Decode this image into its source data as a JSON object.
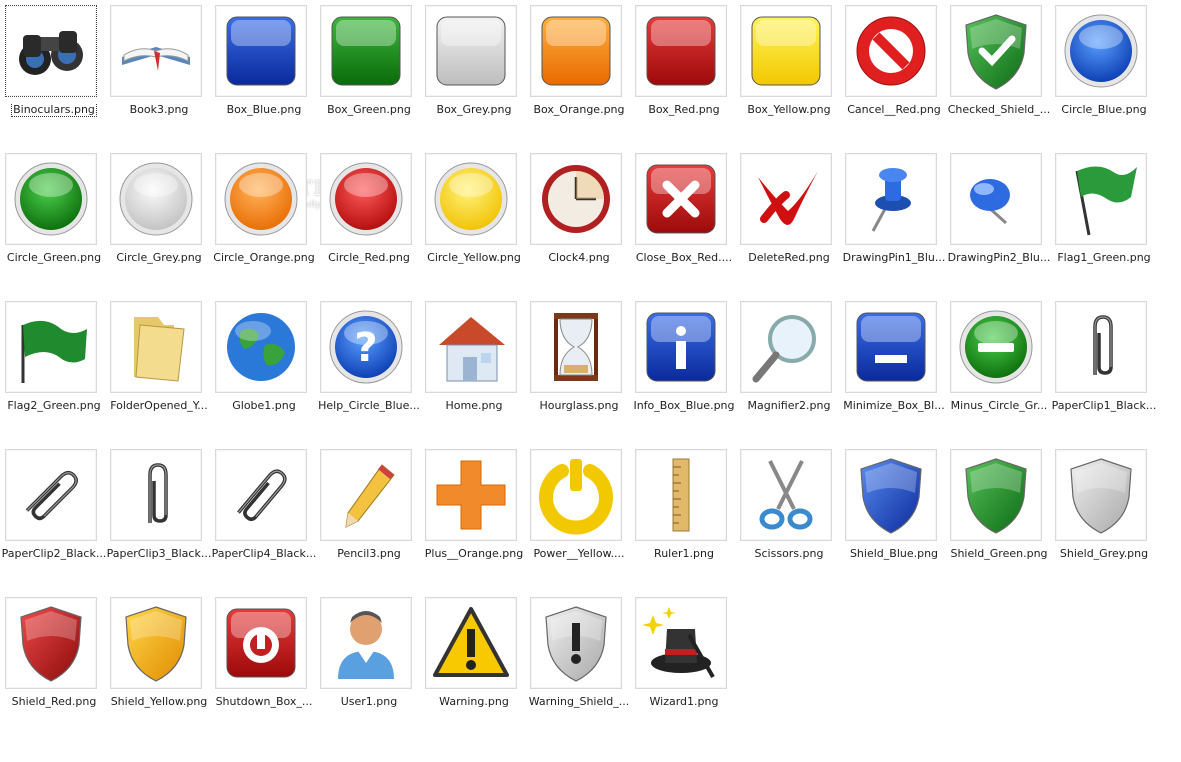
{
  "items": [
    {
      "label": "Binoculars.png",
      "icon": "binoculars-icon",
      "selected": true
    },
    {
      "label": "Book3.png",
      "icon": "book-icon"
    },
    {
      "label": "Box_Blue.png",
      "icon": "box-blue-icon"
    },
    {
      "label": "Box_Green.png",
      "icon": "box-green-icon"
    },
    {
      "label": "Box_Grey.png",
      "icon": "box-grey-icon"
    },
    {
      "label": "Box_Orange.png",
      "icon": "box-orange-icon"
    },
    {
      "label": "Box_Red.png",
      "icon": "box-red-icon"
    },
    {
      "label": "Box_Yellow.png",
      "icon": "box-yellow-icon"
    },
    {
      "label": "Cancel__Red.png",
      "icon": "cancel-red-icon"
    },
    {
      "label": "Checked_Shield_...",
      "icon": "checked-shield-icon"
    },
    {
      "label": "Circle_Blue.png",
      "icon": "circle-blue-icon"
    },
    {
      "label": "Circle_Green.png",
      "icon": "circle-green-icon"
    },
    {
      "label": "Circle_Grey.png",
      "icon": "circle-grey-icon"
    },
    {
      "label": "Circle_Orange.png",
      "icon": "circle-orange-icon"
    },
    {
      "label": "Circle_Red.png",
      "icon": "circle-red-icon"
    },
    {
      "label": "Circle_Yellow.png",
      "icon": "circle-yellow-icon"
    },
    {
      "label": "Clock4.png",
      "icon": "clock-icon"
    },
    {
      "label": "Close_Box_Red....",
      "icon": "close-box-red-icon"
    },
    {
      "label": "DeleteRed.png",
      "icon": "delete-red-icon"
    },
    {
      "label": "DrawingPin1_Blu...",
      "icon": "drawing-pin-icon"
    },
    {
      "label": "DrawingPin2_Blu...",
      "icon": "drawing-pin2-icon"
    },
    {
      "label": "Flag1_Green.png",
      "icon": "flag-green-icon"
    },
    {
      "label": "Flag2_Green.png",
      "icon": "flag2-green-icon"
    },
    {
      "label": "FolderOpened_Y...",
      "icon": "folder-open-icon"
    },
    {
      "label": "Globe1.png",
      "icon": "globe-icon"
    },
    {
      "label": "Help_Circle_Blue...",
      "icon": "help-circle-icon"
    },
    {
      "label": "Home.png",
      "icon": "home-icon"
    },
    {
      "label": "Hourglass.png",
      "icon": "hourglass-icon"
    },
    {
      "label": "Info_Box_Blue.png",
      "icon": "info-box-icon"
    },
    {
      "label": "Magnifier2.png",
      "icon": "magnifier-icon"
    },
    {
      "label": "Minimize_Box_Bl...",
      "icon": "minimize-box-icon"
    },
    {
      "label": "Minus_Circle_Gr...",
      "icon": "minus-circle-icon"
    },
    {
      "label": "PaperClip1_Black...",
      "icon": "paperclip-icon"
    },
    {
      "label": "PaperClip2_Black...",
      "icon": "paperclip2-icon"
    },
    {
      "label": "PaperClip3_Black...",
      "icon": "paperclip3-icon"
    },
    {
      "label": "PaperClip4_Black...",
      "icon": "paperclip4-icon"
    },
    {
      "label": "Pencil3.png",
      "icon": "pencil-icon"
    },
    {
      "label": "Plus__Orange.png",
      "icon": "plus-orange-icon"
    },
    {
      "label": "Power__Yellow....",
      "icon": "power-yellow-icon"
    },
    {
      "label": "Ruler1.png",
      "icon": "ruler-icon"
    },
    {
      "label": "Scissors.png",
      "icon": "scissors-icon"
    },
    {
      "label": "Shield_Blue.png",
      "icon": "shield-blue-icon"
    },
    {
      "label": "Shield_Green.png",
      "icon": "shield-green-icon"
    },
    {
      "label": "Shield_Grey.png",
      "icon": "shield-grey-icon"
    },
    {
      "label": "Shield_Red.png",
      "icon": "shield-red-icon"
    },
    {
      "label": "Shield_Yellow.png",
      "icon": "shield-yellow-icon"
    },
    {
      "label": "Shutdown_Box_...",
      "icon": "shutdown-box-icon"
    },
    {
      "label": "User1.png",
      "icon": "user-icon"
    },
    {
      "label": "Warning.png",
      "icon": "warning-icon"
    },
    {
      "label": "Warning_Shield_...",
      "icon": "warning-shield-icon"
    },
    {
      "label": "Wizard1.png",
      "icon": "wizard-hat-icon"
    }
  ],
  "watermark": {
    "text": "SOFTPEDIA",
    "sub": "www.softpedia.com"
  }
}
